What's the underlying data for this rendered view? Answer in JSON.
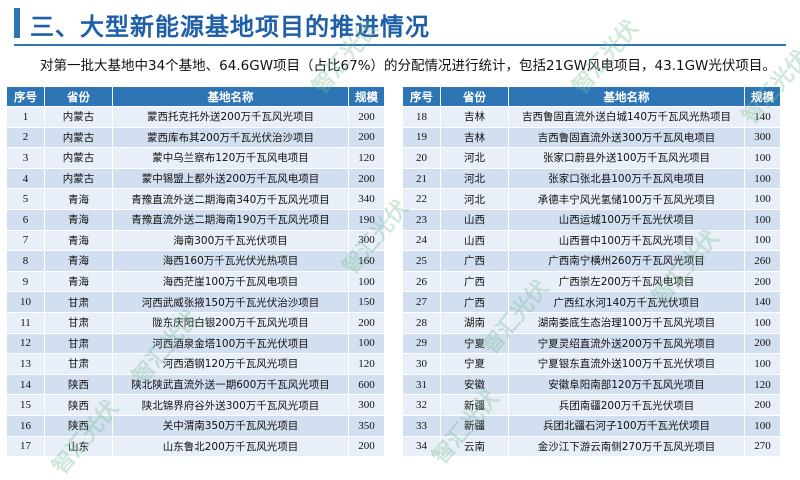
{
  "page": {
    "title": "三、大型新能源基地项目的推进情况",
    "subtitle": "对第一批大基地中34个基地、64.6GW项目（占比67%）的分配情况进行统计，包括21GW风电项目，43.1GW光伏项目。"
  },
  "table": {
    "headers": [
      "序号",
      "省份",
      "基地名称",
      "规模"
    ],
    "left_rows": [
      [
        "1",
        "内蒙古",
        "蒙西托克托外送200万千瓦风光项目",
        "200"
      ],
      [
        "2",
        "内蒙古",
        "蒙西库布其200万千瓦光伏治沙项目",
        "200"
      ],
      [
        "3",
        "内蒙古",
        "蒙中乌兰察布120万千瓦风电项目",
        "120"
      ],
      [
        "4",
        "内蒙古",
        "蒙中锡盟上都外送200万千瓦风电项目",
        "200"
      ],
      [
        "5",
        "青海",
        "青豫直流外送二期海南340万千瓦风光项目",
        "340"
      ],
      [
        "6",
        "青海",
        "青豫直流外送二期海南190万千瓦风光项目",
        "190"
      ],
      [
        "7",
        "青海",
        "海南300万千瓦光伏项目",
        "300"
      ],
      [
        "8",
        "青海",
        "海西160万千瓦光伏光热项目",
        "160"
      ],
      [
        "9",
        "青海",
        "海西茫崖100万千瓦风电项目",
        "100"
      ],
      [
        "10",
        "甘肃",
        "河西武威张掖150万千瓦光伏治沙项目",
        "150"
      ],
      [
        "11",
        "甘肃",
        "陇东庆阳白银200万千瓦风光项目",
        "200"
      ],
      [
        "12",
        "甘肃",
        "河西酒泉金塔100万千瓦光伏项目",
        "100"
      ],
      [
        "13",
        "甘肃",
        "河西酒钢120万千瓦风光项目",
        "120"
      ],
      [
        "14",
        "陕西",
        "陕北陕武直流外送一期600万千瓦风光项目",
        "600"
      ],
      [
        "15",
        "陕西",
        "陕北锦界府谷外送300万千瓦风光项目",
        "300"
      ],
      [
        "16",
        "陕西",
        "关中渭南350万千瓦风光项目",
        "350"
      ],
      [
        "17",
        "山东",
        "山东鲁北200万千瓦风光项目",
        "200"
      ]
    ],
    "right_rows": [
      [
        "18",
        "吉林",
        "吉西鲁固直流外送白城140万千瓦风光热项目",
        "140"
      ],
      [
        "19",
        "吉林",
        "吉西鲁固直流外送300万千瓦风电项目",
        "300"
      ],
      [
        "20",
        "河北",
        "张家口蔚县外送100万千瓦风光项目",
        "100"
      ],
      [
        "21",
        "河北",
        "张家口张北县100万千瓦风电项目",
        "100"
      ],
      [
        "22",
        "河北",
        "承德丰宁风光氢储100万千瓦风光项目",
        "100"
      ],
      [
        "23",
        "山西",
        "山西运城100万千瓦光伏项目",
        "100"
      ],
      [
        "24",
        "山西",
        "山西晋中100万千瓦风光项目",
        "100"
      ],
      [
        "25",
        "广西",
        "广西南宁横州260万千瓦风光项目",
        "260"
      ],
      [
        "26",
        "广西",
        "广西崇左200万千瓦风电项目",
        "200"
      ],
      [
        "27",
        "广西",
        "广西红水河140万千瓦光伏项目",
        "140"
      ],
      [
        "28",
        "湖南",
        "湖南娄底生态治理100万千瓦风光项目",
        "100"
      ],
      [
        "29",
        "宁夏",
        "宁夏灵绍直流外送200万千瓦风光项目",
        "200"
      ],
      [
        "30",
        "宁夏",
        "宁夏银东直流外送100万千瓦光伏项目",
        "100"
      ],
      [
        "31",
        "安徽",
        "安徽阜阳南部120万千瓦风光项目",
        "120"
      ],
      [
        "32",
        "新疆",
        "兵团南疆200万千瓦光伏项目",
        "200"
      ],
      [
        "33",
        "新疆",
        "兵团北疆石河子100万千瓦光伏项目",
        "100"
      ],
      [
        "34",
        "云南",
        "金沙江下游云南侧270万千瓦风光项目",
        "270"
      ]
    ]
  },
  "watermark": {
    "text": "智汇光伏"
  },
  "colors": {
    "accent": "#2e75b6",
    "row_light": "#e8eff8",
    "row_dark": "#d2dff0"
  }
}
